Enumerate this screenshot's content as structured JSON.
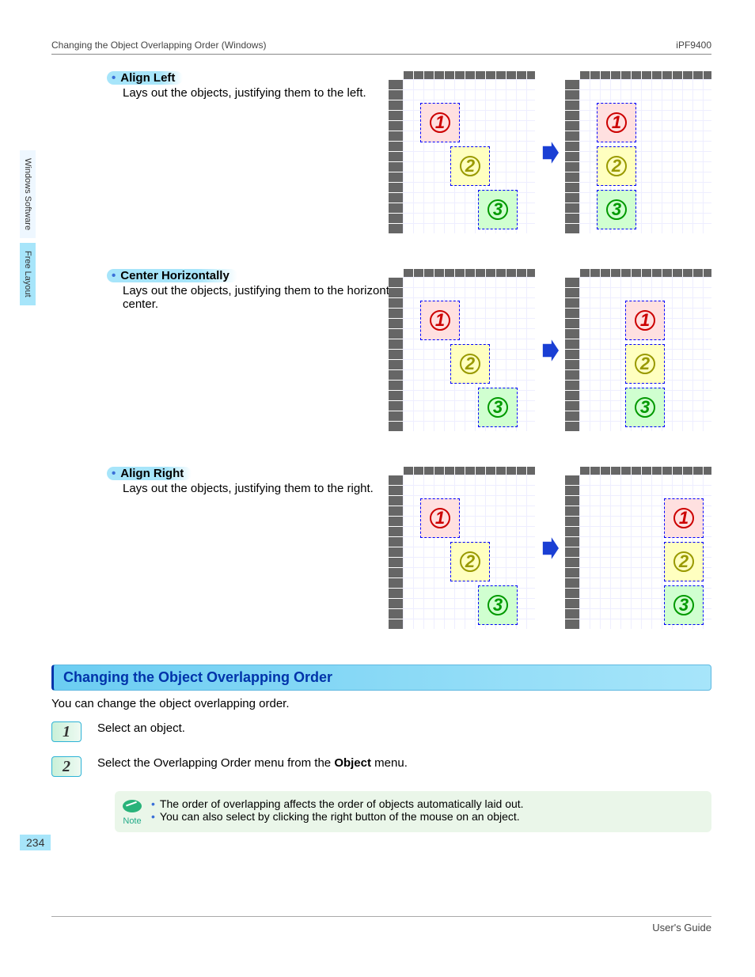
{
  "header": {
    "left": "Changing the Object Overlapping Order (Windows)",
    "right": "iPF9400"
  },
  "tabs": {
    "a": "Windows Software",
    "b": "Free Layout"
  },
  "items": [
    {
      "title": "Align Left",
      "desc": "Lays out the objects, justifying them to the left."
    },
    {
      "title": "Center Horizontally",
      "desc": "Lays out the objects, justifying them to the horizontal center."
    },
    {
      "title": "Align Right",
      "desc": "Lays out the objects, justifying them to the right."
    }
  ],
  "section": {
    "title": "Changing the Object Overlapping Order",
    "intro": "You can change the object overlapping order.",
    "steps": {
      "s1_num": "1",
      "s1_text": "Select an object.",
      "s2_num": "2",
      "s2_text_a": "Select the Overlapping Order menu from the ",
      "s2_text_b": "Object",
      "s2_text_c": " menu."
    },
    "note": {
      "label": "Note",
      "items": [
        "The order of overlapping affects the order of objects automatically laid out.",
        "You can also select by clicking the right button of the mouse on an object."
      ]
    }
  },
  "footer": {
    "page": "234",
    "guide": "User's Guide"
  },
  "dia": {
    "n1": "1",
    "n2": "2",
    "n3": "3"
  }
}
